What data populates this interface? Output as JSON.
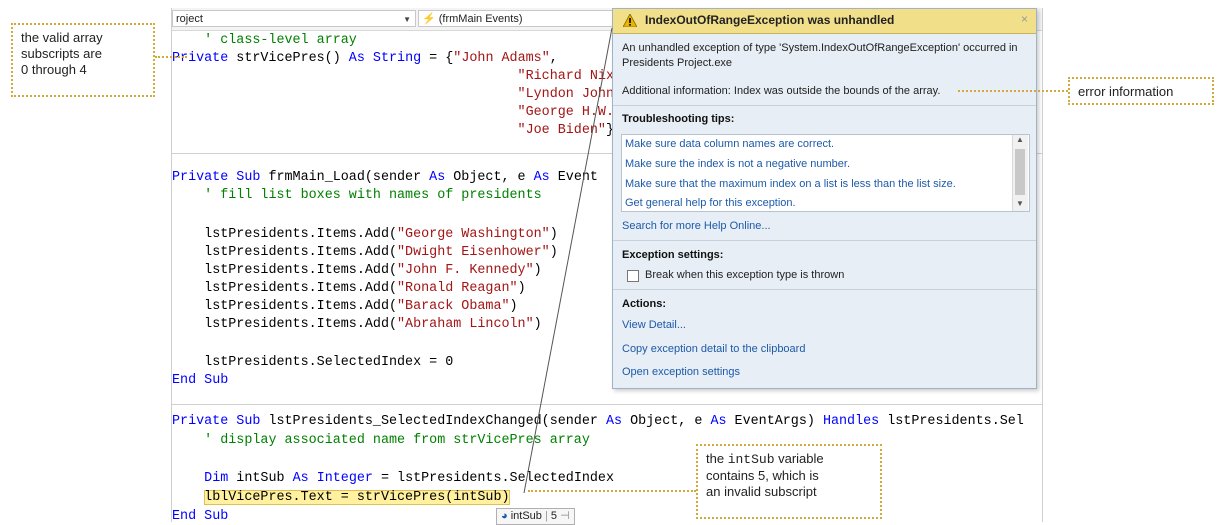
{
  "nav_bar": {
    "project_dropdown": "roject",
    "events_dropdown": "(frmMain Events)",
    "lightning_icon": "lightning-icon"
  },
  "code_lines": {
    "l1": "' class-level array",
    "l2_kw1": "Private",
    "l2_mid": " strVicePres() ",
    "l2_kw2": "As",
    "l2_sp": " ",
    "l2_kw3": "String",
    "l2_eq": " = {",
    "l2_str": "\"John Adams\"",
    "l2_end": ",",
    "l3_str": "\"Richard Nixon\"",
    "l3_end": ",",
    "l4_str": "\"Lyndon Johnson\"",
    "l4_end": ",",
    "l5_str": "\"George H.W. Bush\"",
    "l6_str": "\"Joe Biden\"",
    "l6_end": "}",
    "l7_kw1": "Private",
    "l7_sp": " ",
    "l7_kw2": "Sub",
    "l7_mid": " frmMain_Load(sender ",
    "l7_kw3": "As",
    "l7_mid2": " Object, e ",
    "l7_kw4": "As",
    "l7_end": " Event",
    "l8": "' fill list boxes with names of presidents",
    "l9_pre": "lstPresidents.Items.Add(",
    "l9_str": "\"George Washington\"",
    "l9_end": ")",
    "l10_pre": "lstPresidents.Items.Add(",
    "l10_str": "\"Dwight Eisenhower\"",
    "l10_end": ")",
    "l11_pre": "lstPresidents.Items.Add(",
    "l11_str": "\"John F. Kennedy\"",
    "l11_end": ")",
    "l12_pre": "lstPresidents.Items.Add(",
    "l12_str": "\"Ronald Reagan\"",
    "l12_end": ")",
    "l13_pre": "lstPresidents.Items.Add(",
    "l13_str": "\"Barack Obama\"",
    "l13_end": ")",
    "l14_pre": "lstPresidents.Items.Add(",
    "l14_str": "\"Abraham Lincoln\"",
    "l14_end": ")",
    "l15": "lstPresidents.SelectedIndex = 0",
    "l16_kw1": "End",
    "l16_sp": " ",
    "l16_kw2": "Sub",
    "l17_kw1": "Private",
    "l17_sp": " ",
    "l17_kw2": "Sub",
    "l17_mid": " lstPresidents_SelectedIndexChanged(sender ",
    "l17_kw3": "As",
    "l17_mid2": " Object, e ",
    "l17_kw4": "As",
    "l17_mid3": " EventArgs) ",
    "l17_kw5": "Handles",
    "l17_end": " lstPresidents.Sel",
    "l18": "' display associated name from strVicePres array",
    "l19_kw1": "Dim",
    "l19_mid": " intSub ",
    "l19_kw2": "As",
    "l19_sp": " ",
    "l19_kw3": "Integer",
    "l19_end": " = lstPresidents.SelectedIndex",
    "l20": "lblVicePres.Text = strVicePres(intSub)",
    "l21_kw1": "End",
    "l21_sp": " ",
    "l21_kw2": "Sub"
  },
  "datatip": {
    "name": "intSub",
    "value": "5"
  },
  "exception": {
    "title": "IndexOutOfRangeException was unhandled",
    "close": "×",
    "message_line1": "An unhandled exception of type 'System.IndexOutOfRangeException' occurred in",
    "message_line2": "Presidents Project.exe",
    "additional": "Additional information: Index was outside the bounds of the array.",
    "tips_heading": "Troubleshooting tips:",
    "tips": [
      "Make sure data column names are correct.",
      "Make sure the index is not a negative number.",
      "Make sure that the maximum index on a list is less than the list size.",
      "Get general help for this exception."
    ],
    "search_link": "Search for more Help Online...",
    "settings_heading": "Exception settings:",
    "break_checkbox": "Break when this exception type is thrown",
    "actions_heading": "Actions:",
    "actions": [
      "View Detail...",
      "Copy exception detail to the clipboard",
      "Open exception settings"
    ]
  },
  "callouts": {
    "subscripts_lines": [
      "the valid array",
      "subscripts are",
      "0 through 4"
    ],
    "error_info": "error information",
    "intsub_line1_pre": "the ",
    "intsub_line1_code": "intSub",
    "intsub_line1_post": " variable",
    "intsub_line2": "contains 5, which is",
    "intsub_line3": "an invalid subscript"
  },
  "colors": {
    "keyword": "#0000ff",
    "string": "#a31515",
    "comment": "#008000",
    "callout_border": "#d2aa3a",
    "exception_header": "#f1df8a",
    "link": "#1d5aa9"
  }
}
